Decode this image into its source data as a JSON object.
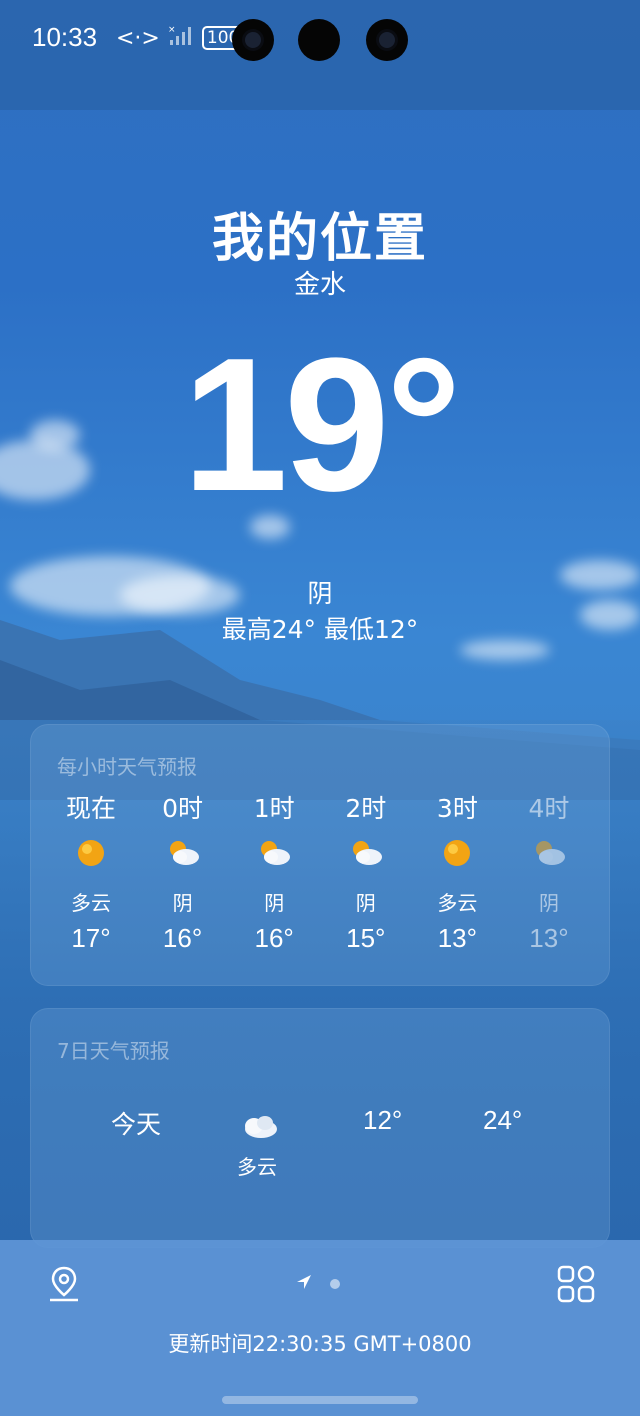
{
  "status_bar": {
    "time": "10:33",
    "link_icon": "<·>",
    "signal_icon": "signal-off",
    "battery": "100"
  },
  "header": {
    "location_title": "我的位置",
    "location_sub": "金水",
    "temperature": "19°",
    "condition": "阴",
    "high_low": "最高24° 最低12°"
  },
  "hourly": {
    "title": "每小时天气预报",
    "items": [
      {
        "time": "现在",
        "icon": "sun",
        "condition": "多云",
        "temp": "17°"
      },
      {
        "time": "0时",
        "icon": "partly-cloudy",
        "condition": "阴",
        "temp": "16°"
      },
      {
        "time": "1时",
        "icon": "partly-cloudy",
        "condition": "阴",
        "temp": "16°"
      },
      {
        "time": "2时",
        "icon": "partly-cloudy",
        "condition": "阴",
        "temp": "15°"
      },
      {
        "time": "3时",
        "icon": "sun",
        "condition": "多云",
        "temp": "13°"
      },
      {
        "time": "4时",
        "icon": "partly-cloudy",
        "condition": "阴",
        "temp": "13°"
      }
    ]
  },
  "daily": {
    "title": "7日天气预报",
    "items": [
      {
        "day": "今天",
        "icon": "cloud",
        "condition": "多云",
        "low": "12°",
        "high": "24°"
      }
    ]
  },
  "bottom": {
    "updated": "更新时间22:30:35 GMT+0800",
    "page_indicator": {
      "current": 1,
      "total": 2
    }
  },
  "colors": {
    "sun": "#f2a414",
    "accent": "#3a86d3"
  }
}
